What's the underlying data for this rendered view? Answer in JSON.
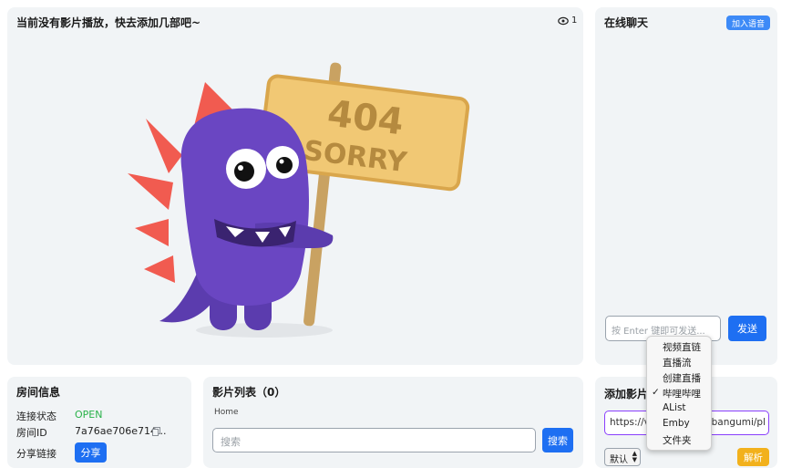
{
  "player": {
    "title": "当前没有影片播放，快去添加几部吧~",
    "viewer_count": "1",
    "image_text_1": "404",
    "image_text_2": "SORRY"
  },
  "chat": {
    "title": "在线聊天",
    "voice_button": "加入语音",
    "input_placeholder": "按 Enter 键即可发送...",
    "send_button": "发送"
  },
  "room_info": {
    "title": "房间信息",
    "status_label": "连接状态",
    "status_value": "OPEN",
    "status_color": "#2ab24a",
    "room_id_label": "房间ID",
    "room_id_value": "7a76ae706e714...",
    "share_label": "分享链接",
    "share_button": "分享"
  },
  "movie_list": {
    "title": "影片列表（0）",
    "breadcrumb": "Home",
    "search_placeholder": "搜索",
    "search_button": "搜索"
  },
  "add_movie": {
    "title": "添加影片",
    "url_prefix": "https://v",
    "url_suffix": "n/bangumi/pl",
    "mode_select": "默认",
    "parse_button": "解析",
    "source_menu": [
      "视频直链",
      "直播流",
      "创建直播",
      "哔哩哔哩",
      "AList",
      "Emby",
      "文件夹"
    ],
    "source_selected_index": 3,
    "check_mark": "✓"
  },
  "colors": {
    "accent": "#1e6ff2",
    "panel": "#f1f4f6",
    "purple_border": "#8a3ffc",
    "parse_yellow": "#f2b11c"
  }
}
